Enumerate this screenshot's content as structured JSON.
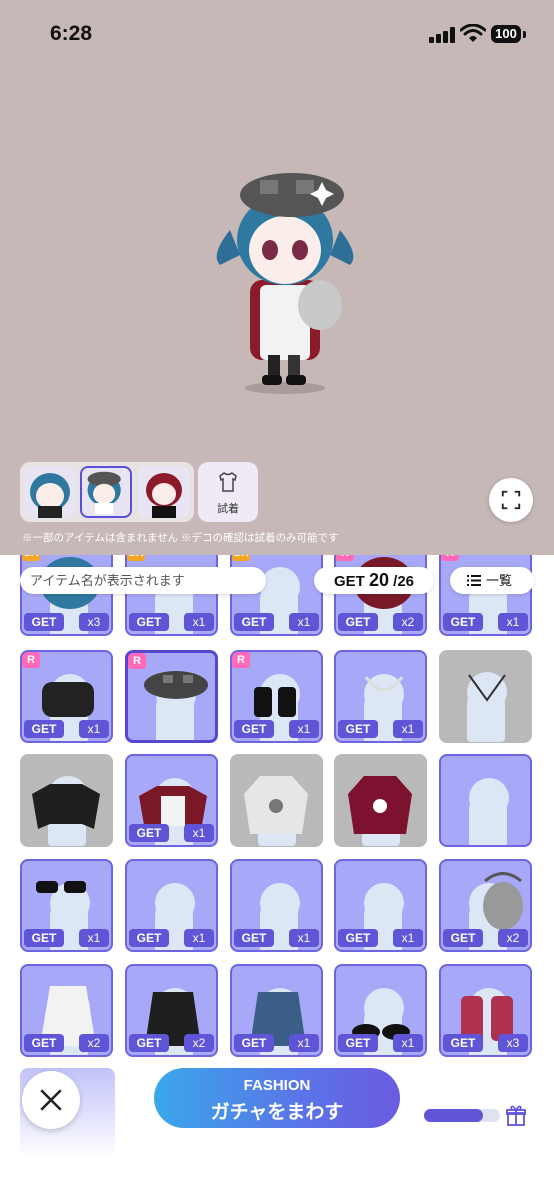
{
  "status": {
    "time": "6:28",
    "battery": "100"
  },
  "stage": {
    "try_on_label": "試着",
    "notice": "※一部のアイテムは含まれません ※デコの確認は試着のみ可能です"
  },
  "toolbar": {
    "search_placeholder": "アイテム名が表示されます",
    "get_prefix": "GET",
    "get_count": "20",
    "get_total": "/26",
    "list_label": "一覧"
  },
  "items": [
    {
      "rarity": "SR",
      "get": "GET",
      "qty": "x3",
      "state": "owned",
      "icon": "blue-hair-icon"
    },
    {
      "rarity": "SR",
      "get": "GET",
      "qty": "x1",
      "state": "owned",
      "icon": "eyes-icon"
    },
    {
      "rarity": "SR",
      "get": "GET",
      "qty": "x1",
      "state": "owned",
      "icon": "eyes-blue-icon"
    },
    {
      "rarity": "R",
      "get": "GET",
      "qty": "x2",
      "state": "owned",
      "icon": "red-hair-icon"
    },
    {
      "rarity": "R",
      "get": "GET",
      "qty": "x1",
      "state": "owned",
      "icon": "accessory-icon"
    },
    {
      "rarity": "R",
      "get": "GET",
      "qty": "x1",
      "state": "owned",
      "icon": "black-jacket-icon"
    },
    {
      "rarity": "R",
      "get": "",
      "qty": "",
      "state": "hl",
      "icon": "checkered-beret-icon"
    },
    {
      "rarity": "R",
      "get": "GET",
      "qty": "x1",
      "state": "owned",
      "icon": "black-boots-icon"
    },
    {
      "rarity": "",
      "get": "GET",
      "qty": "x1",
      "state": "owned",
      "icon": "necklace-icon"
    },
    {
      "rarity": "",
      "get": "",
      "qty": "",
      "state": "empty",
      "icon": "cross-necklace-icon"
    },
    {
      "rarity": "",
      "get": "",
      "qty": "",
      "state": "empty",
      "icon": "black-top-icon"
    },
    {
      "rarity": "",
      "get": "GET",
      "qty": "x1",
      "state": "owned",
      "icon": "red-top-icon"
    },
    {
      "rarity": "",
      "get": "",
      "qty": "",
      "state": "empty",
      "icon": "grey-hoodie-icon"
    },
    {
      "rarity": "",
      "get": "",
      "qty": "",
      "state": "empty",
      "icon": "red-hoodie-icon"
    },
    {
      "rarity": "",
      "get": "",
      "qty": "",
      "state": "owned",
      "icon": "ribbon-clip-icon"
    },
    {
      "rarity": "",
      "get": "GET",
      "qty": "x1",
      "state": "owned",
      "icon": "sunglasses-icon"
    },
    {
      "rarity": "",
      "get": "GET",
      "qty": "x1",
      "state": "owned",
      "icon": "earring-icon"
    },
    {
      "rarity": "",
      "get": "GET",
      "qty": "x1",
      "state": "owned",
      "icon": "earring-chain-icon"
    },
    {
      "rarity": "",
      "get": "GET",
      "qty": "x1",
      "state": "owned",
      "icon": "earring-pearl-icon"
    },
    {
      "rarity": "",
      "get": "GET",
      "qty": "x2",
      "state": "owned",
      "icon": "chain-bag-icon"
    },
    {
      "rarity": "",
      "get": "GET",
      "qty": "x2",
      "state": "owned",
      "icon": "white-dress-icon"
    },
    {
      "rarity": "",
      "get": "GET",
      "qty": "x2",
      "state": "owned",
      "icon": "black-skirt-icon"
    },
    {
      "rarity": "",
      "get": "GET",
      "qty": "x1",
      "state": "owned",
      "icon": "denim-skirt-icon"
    },
    {
      "rarity": "",
      "get": "GET",
      "qty": "x1",
      "state": "owned",
      "icon": "mary-jane-shoes-icon"
    },
    {
      "rarity": "",
      "get": "GET",
      "qty": "x3",
      "state": "owned",
      "icon": "red-lace-socks-icon"
    }
  ],
  "footer": {
    "gacha_line1": "FASHION",
    "gacha_line2": "ガチャをまわす",
    "progress": 0.78
  },
  "colors": {
    "accent": "#5f55d6",
    "stage_bg": "#c6b8b6",
    "owned_bg": "#a7a8f7"
  }
}
